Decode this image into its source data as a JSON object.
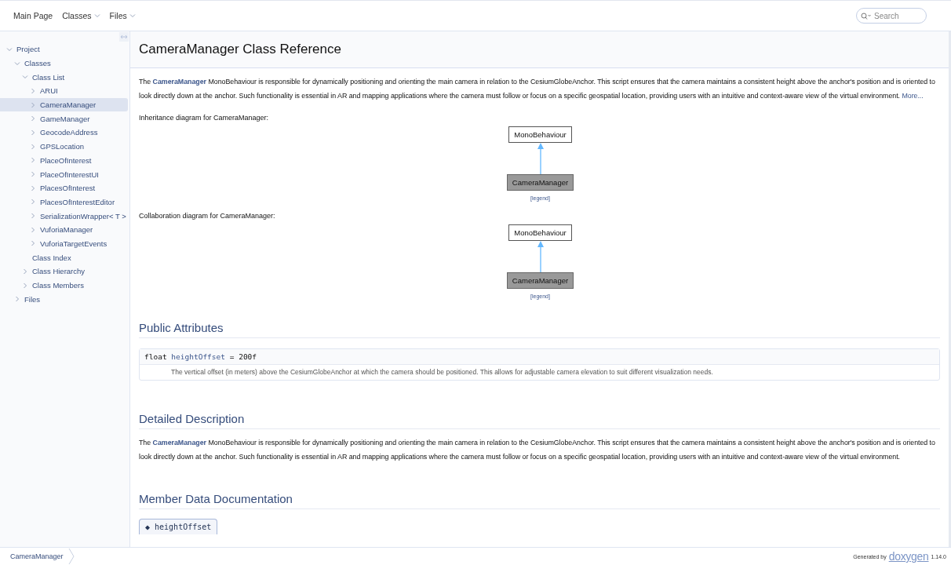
{
  "top_nav": {
    "menu": [
      {
        "label": "Main Page",
        "dropdown": false
      },
      {
        "label": "Classes",
        "dropdown": true
      },
      {
        "label": "Files",
        "dropdown": true
      }
    ],
    "search": {
      "placeholder": "Search"
    }
  },
  "sidebar": {
    "tree": [
      {
        "label": "Project",
        "kind": "node",
        "expanded": true,
        "selected": false,
        "children": [
          {
            "label": "Classes",
            "kind": "node",
            "expanded": true,
            "selected": false,
            "children": [
              {
                "label": "Class List",
                "kind": "node",
                "expanded": true,
                "selected": false,
                "children": [
                  {
                    "label": "ARUI",
                    "kind": "node",
                    "expanded": false,
                    "selected": false
                  },
                  {
                    "label": "CameraManager",
                    "kind": "node",
                    "expanded": false,
                    "selected": true
                  },
                  {
                    "label": "GameManager",
                    "kind": "node",
                    "expanded": false,
                    "selected": false
                  },
                  {
                    "label": "GeocodeAddress",
                    "kind": "node",
                    "expanded": false,
                    "selected": false
                  },
                  {
                    "label": "GPSLocation",
                    "kind": "node",
                    "expanded": false,
                    "selected": false
                  },
                  {
                    "label": "PlaceOfInterest",
                    "kind": "node",
                    "expanded": false,
                    "selected": false
                  },
                  {
                    "label": "PlaceOfInterestUI",
                    "kind": "node",
                    "expanded": false,
                    "selected": false
                  },
                  {
                    "label": "PlacesOfInterest",
                    "kind": "node",
                    "expanded": false,
                    "selected": false
                  },
                  {
                    "label": "PlacesOfInterestEditor",
                    "kind": "node",
                    "expanded": false,
                    "selected": false
                  },
                  {
                    "label": "SerializationWrapper< T >",
                    "kind": "node",
                    "expanded": false,
                    "selected": false
                  },
                  {
                    "label": "VuforiaManager",
                    "kind": "node",
                    "expanded": false,
                    "selected": false
                  },
                  {
                    "label": "VuforiaTargetEvents",
                    "kind": "node",
                    "expanded": false,
                    "selected": false
                  }
                ]
              },
              {
                "label": "Class Index",
                "kind": "leaf",
                "expanded": false,
                "selected": false
              },
              {
                "label": "Class Hierarchy",
                "kind": "node",
                "expanded": false,
                "selected": false
              },
              {
                "label": "Class Members",
                "kind": "node",
                "expanded": false,
                "selected": false
              }
            ]
          },
          {
            "label": "Files",
            "kind": "node",
            "expanded": false,
            "selected": false
          }
        ]
      }
    ]
  },
  "content": {
    "title": "CameraManager Class Reference",
    "brief": "The **CameraManager** MonoBehaviour is responsible for dynamically positioning and orienting the main camera in relation to the CesiumGlobeAnchor. This script ensures that the camera maintains a consistent height above the anchor's position and is oriented to look directly down at the anchor. Such functionality is essential in AR and mapping applications where the camera must follow or focus on a specific geospatial location, providing users with an intuitive and context-aware view of the virtual environment.",
    "more_link": "More...",
    "diagrams": [
      {
        "caption": "Inheritance diagram for CameraManager:",
        "base": "MonoBehaviour",
        "derived": "CameraManager",
        "legend": "[legend]"
      },
      {
        "caption": "Collaboration diagram for CameraManager:",
        "base": "MonoBehaviour",
        "derived": "CameraManager",
        "legend": "[legend]"
      }
    ],
    "public_attributes": {
      "heading": "Public Attributes",
      "members": [
        {
          "type": "float",
          "name": "heightOffset",
          "initializer": "= 200f",
          "description": "The vertical offset (in meters) above the CesiumGlobeAnchor at which the camera should be positioned. This allows for adjustable camera elevation to suit different visualization needs."
        }
      ]
    },
    "detailed": {
      "heading": "Detailed Description",
      "text": "The **CameraManager** MonoBehaviour is responsible for dynamically positioning and orienting the main camera in relation to the CesiumGlobeAnchor. This script ensures that the camera maintains a consistent height above the anchor's position and is oriented to look directly down at the anchor. Such functionality is essential in AR and mapping applications where the camera must follow or focus on a specific geospatial location, providing users with an intuitive and context-aware view of the virtual environment."
    },
    "member_docs": {
      "heading": "Member Data Documentation",
      "items": [
        {
          "marker": "◆",
          "name": "heightOffset"
        }
      ]
    }
  },
  "footer": {
    "breadcrumb": "CameraManager",
    "generated_by": "Generated by",
    "logo": "doxygen",
    "version": "1.14.0"
  }
}
